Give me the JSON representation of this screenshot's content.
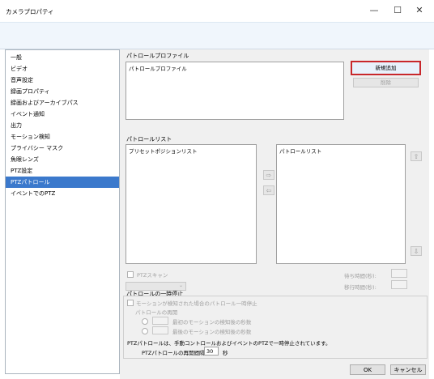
{
  "window": {
    "title": "カメラプロパティ",
    "minimize": "—",
    "maximize": "☐",
    "close": "✕"
  },
  "sidebar": {
    "items": [
      {
        "label": "一般"
      },
      {
        "label": "ビデオ"
      },
      {
        "label": "音声設定"
      },
      {
        "label": "録画プロパティ"
      },
      {
        "label": "録画およびアーカイブパス"
      },
      {
        "label": "イベント通知"
      },
      {
        "label": "出力"
      },
      {
        "label": "モーション検知"
      },
      {
        "label": "プライバシー マスク"
      },
      {
        "label": "魚眼レンズ"
      },
      {
        "label": "PTZ設定"
      },
      {
        "label": "PTZパトロール"
      },
      {
        "label": "イベントでのPTZ"
      }
    ],
    "selected_index": 11
  },
  "profile": {
    "section_label": "パトロールプロファイル",
    "list_header": "パトロールプロファイル",
    "add_button": "新規追加",
    "delete_button": "削除"
  },
  "patrol_list": {
    "section_label": "パトロールリスト",
    "preset_header": "プリセットポジションリスト",
    "patrol_header": "パトロールリスト",
    "move_right": "⇨",
    "move_left": "⇦",
    "up": "⇧",
    "down": "⇩",
    "ptz_scan_label": "PTZスキャン",
    "wait_time_label": "待ち時間(秒):",
    "transition_time_label": "移行時間(秒):"
  },
  "pause": {
    "section_label": "パトロールの一時停止",
    "motion_checkbox": "モーションが検知された場合のパトロール一時停止",
    "resume_label": "パトロールの再開",
    "radio_first": "最初のモーションの検知後の秒数",
    "radio_last": "最後のモーションの検知後の秒数",
    "manual_note": "PTZパトロールは、手動コントロールおよびイベントのPTZで一時停止されています。",
    "resume_interval_label": "PTZパトロールの再開間隔:",
    "resume_interval_value": "30",
    "resume_interval_unit": "秒"
  },
  "footer": {
    "ok": "OK",
    "cancel": "キャンセル"
  },
  "colors": {
    "accent": "#3b79cc",
    "highlight_border": "#c8272b"
  }
}
